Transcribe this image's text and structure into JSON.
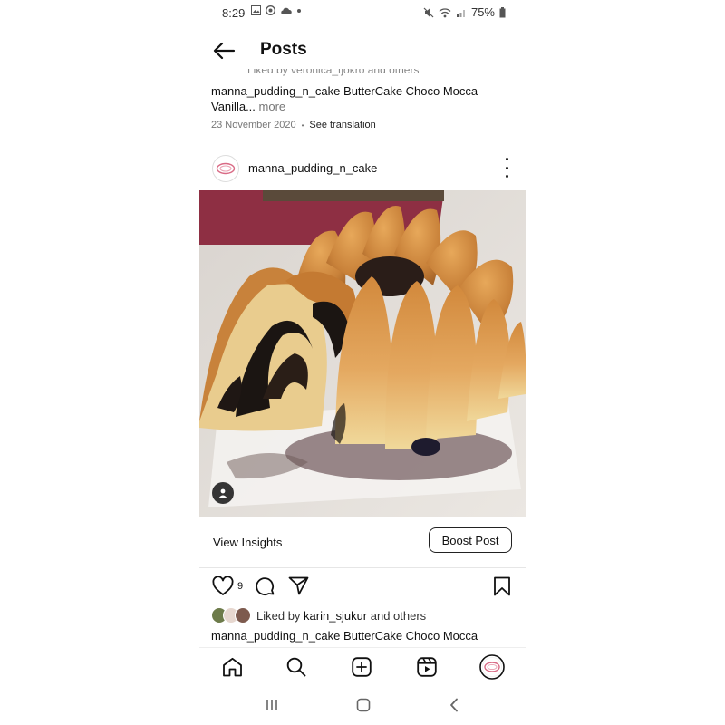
{
  "status_bar": {
    "time": "8:29",
    "battery": "75%"
  },
  "header": {
    "title": "Posts"
  },
  "previous_post": {
    "liked_by_partial": "Liked by veronica_tjokro and others",
    "caption_user": "manna_pudding_n_cake",
    "caption_text": " ButterCake Choco Mocca Vanilla",
    "ellipsis": "...",
    "more_label": "more",
    "date": "23 November 2020",
    "dot": "•",
    "see_translation": "See translation"
  },
  "post": {
    "username": "manna_pudding_n_cake",
    "view_insights": "View Insights",
    "boost_post": "Boost Post",
    "like_count": "9",
    "liked_by_prefix": "Liked by ",
    "liked_by_user": "karin_sjukur",
    "liked_by_suffix": " and others",
    "caption_user": "manna_pudding_n_cake",
    "caption_text": " ButterCake Choco Mocca"
  },
  "icons": {
    "status": [
      "gallery-icon",
      "app-icon",
      "cloud-icon",
      "mute-icon",
      "wifi-icon",
      "signal-icon",
      "battery-icon"
    ],
    "actions": [
      "heart-icon",
      "comment-icon",
      "share-icon",
      "bookmark-icon"
    ],
    "nav": [
      "home-icon",
      "search-icon",
      "create-icon",
      "reels-icon",
      "profile-avatar"
    ]
  },
  "colors": {
    "accent_pink": "#d96b86",
    "text": "#111111",
    "muted": "#777777"
  }
}
